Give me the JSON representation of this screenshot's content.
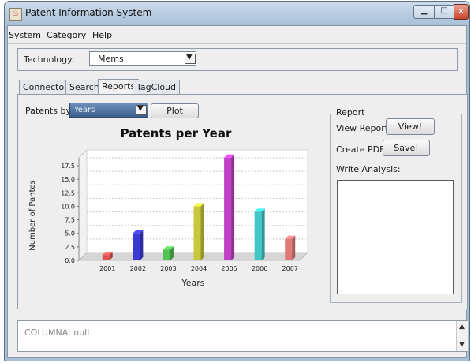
{
  "window": {
    "title": "Patent Information System"
  },
  "menu": {
    "items": [
      "System",
      "Category",
      "Help"
    ]
  },
  "technology": {
    "label": "Technology:",
    "value": "Mems"
  },
  "tabs": [
    "Connector",
    "Search",
    "Reports",
    "TagCloud"
  ],
  "reports": {
    "patents_by_label": "Patents by :",
    "patents_by_value": "Years",
    "plot_label": "Plot"
  },
  "report_panel": {
    "legend": "Report",
    "view_label": "View Report:",
    "view_button": "View!",
    "pdf_label": "Create PDF:",
    "save_button": "Save!",
    "analysis_label": "Write Analysis:"
  },
  "console": {
    "text": "COLUMNA: null"
  },
  "chart_data": {
    "type": "bar",
    "title": "Patents per Year",
    "xlabel": "Years",
    "ylabel": "Number of Pantes",
    "categories": [
      "2001",
      "2002",
      "2003",
      "2004",
      "2005",
      "2006",
      "2007"
    ],
    "values": [
      1,
      5,
      2,
      10,
      19,
      9,
      4
    ],
    "ylim": [
      0,
      17.5
    ],
    "yticks": [
      "0.0",
      "2.5",
      "5.0",
      "7.5",
      "10.0",
      "12.5",
      "15.0",
      "17.5"
    ],
    "colors": [
      "#e05050",
      "#3a3ad0",
      "#52c052",
      "#c8c83c",
      "#c040c8",
      "#40c8c8",
      "#e07878"
    ],
    "grid": true
  }
}
